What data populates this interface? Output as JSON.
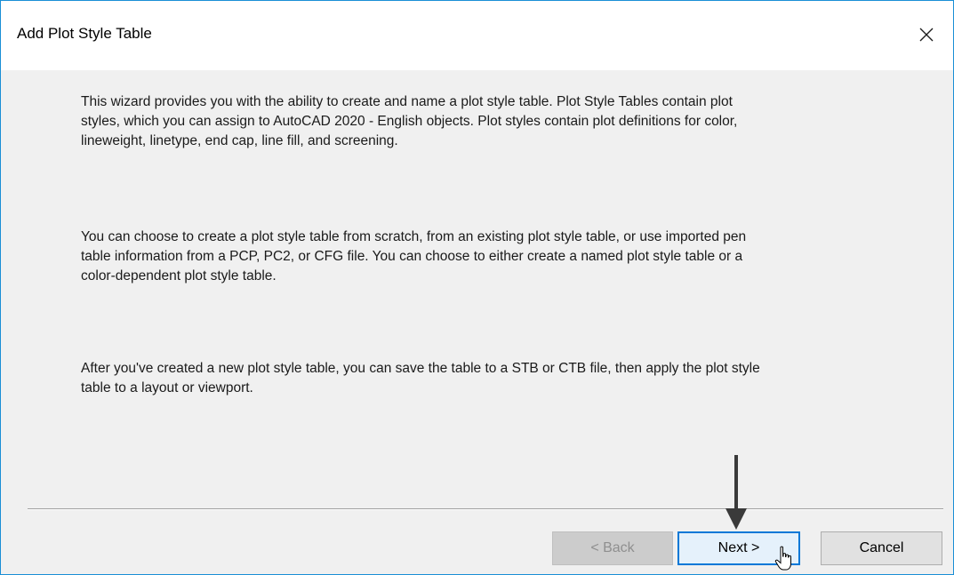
{
  "dialog": {
    "title": "Add Plot Style Table",
    "paragraphs": [
      "This wizard provides you with the ability to create and name a plot style table. Plot Style Tables contain plot styles, which you can assign to AutoCAD 2020 - English objects. Plot styles contain plot definitions for color, lineweight, linetype, end cap, line fill, and screening.",
      "You can choose to create a plot style table from scratch, from an existing plot style table, or use imported pen table information from a PCP, PC2, or CFG file. You can choose to either create a named plot style table or a color-dependent plot style table.",
      "After you've created a new plot style table, you can save the table to a STB or CTB file, then apply the plot style table to a layout or viewport."
    ]
  },
  "buttons": {
    "back": "< Back",
    "next": "Next >",
    "cancel": "Cancel"
  },
  "icons": {
    "close": "close-icon",
    "arrow": "down-arrow-icon",
    "cursor": "hand-cursor-icon"
  },
  "colors": {
    "window_border": "#1a8fd6",
    "focus_border": "#0078d7",
    "background": "#f0f0f0"
  }
}
